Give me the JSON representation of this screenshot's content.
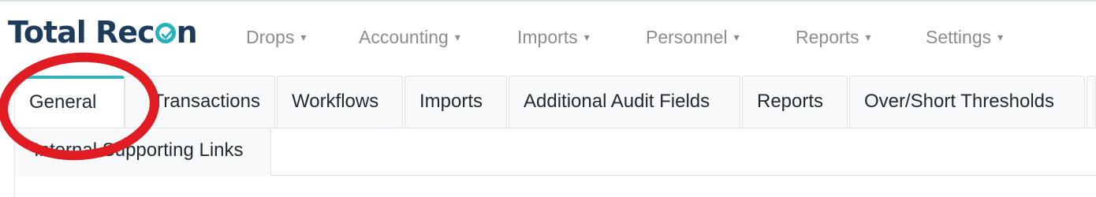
{
  "app": {
    "name_part1": "Total Rec",
    "name_part2": "n",
    "logo_accent": "#27b1bf",
    "logo_text_color": "#1d3c5c"
  },
  "nav": {
    "items": [
      {
        "label": "Drops"
      },
      {
        "label": "Accounting"
      },
      {
        "label": "Imports"
      },
      {
        "label": "Personnel"
      },
      {
        "label": "Reports"
      },
      {
        "label": "Settings"
      }
    ],
    "caret": "▾"
  },
  "tabs": {
    "items": [
      {
        "label": "General",
        "active": true
      },
      {
        "label": "Transactions"
      },
      {
        "label": "Workflows"
      },
      {
        "label": "Imports"
      },
      {
        "label": "Additional Audit Fields"
      },
      {
        "label": "Reports"
      },
      {
        "label": "Over/Short Thresholds"
      },
      {
        "label": "Internal Supporting Links"
      }
    ],
    "active_color": "#37b3bf"
  },
  "annotation": {
    "shape": "ellipse",
    "color": "#e01b22"
  }
}
